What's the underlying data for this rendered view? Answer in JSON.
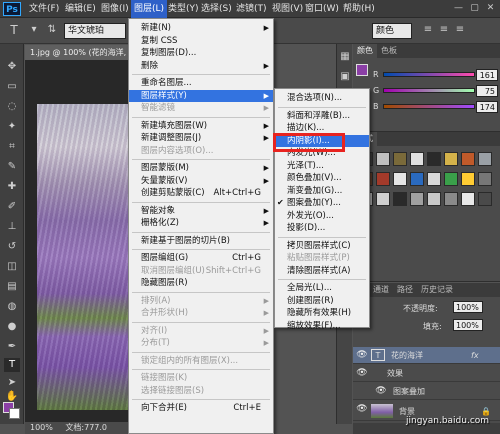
{
  "app": {
    "logo": "Ps"
  },
  "menubar": {
    "items": [
      "文件(F)",
      "编辑(E)",
      "图像(I)",
      "图层(L)",
      "类型(Y)",
      "选择(S)",
      "滤镜(T)",
      "视图(V)",
      "窗口(W)",
      "帮助(H)"
    ],
    "active": "图层(L)",
    "window_buttons": [
      "—",
      "▢",
      "✕"
    ]
  },
  "options_bar": {
    "font_family": "华文琥珀",
    "font_style": "颜色"
  },
  "document": {
    "tab_title": "1.jpg @ 100% (花的海洋, R",
    "zoom": "100%",
    "status": "文档:777.0"
  },
  "layer_menu": {
    "items": [
      {
        "label": "新建(N)",
        "shortcut": "",
        "submenu": true,
        "disabled": false
      },
      {
        "label": "复制 CSS",
        "shortcut": "",
        "submenu": false,
        "disabled": false
      },
      {
        "label": "复制图层(D)...",
        "shortcut": "",
        "submenu": false,
        "disabled": false
      },
      {
        "label": "删除",
        "shortcut": "",
        "submenu": true,
        "disabled": false
      },
      {
        "label": "重命名图层...",
        "shortcut": "",
        "submenu": false,
        "disabled": false
      },
      {
        "label": "图层样式(Y)",
        "shortcut": "",
        "submenu": true,
        "disabled": false,
        "highlighted": true
      },
      {
        "label": "智能滤镜",
        "shortcut": "",
        "submenu": true,
        "disabled": true
      },
      {
        "label": "新建填充图层(W)",
        "shortcut": "",
        "submenu": true,
        "disabled": false
      },
      {
        "label": "新建调整图层(J)",
        "shortcut": "",
        "submenu": true,
        "disabled": false
      },
      {
        "label": "图层内容选项(O)...",
        "shortcut": "",
        "submenu": false,
        "disabled": true
      },
      {
        "label": "图层蒙版(M)",
        "shortcut": "",
        "submenu": true,
        "disabled": false
      },
      {
        "label": "矢量蒙版(V)",
        "shortcut": "",
        "submenu": true,
        "disabled": false
      },
      {
        "label": "创建剪贴蒙版(C)",
        "shortcut": "Alt+Ctrl+G",
        "submenu": false,
        "disabled": false
      },
      {
        "label": "智能对象",
        "shortcut": "",
        "submenu": true,
        "disabled": false
      },
      {
        "label": "栅格化(Z)",
        "shortcut": "",
        "submenu": true,
        "disabled": false
      },
      {
        "label": "新建基于图层的切片(B)",
        "shortcut": "",
        "submenu": false,
        "disabled": false
      },
      {
        "label": "图层编组(G)",
        "shortcut": "Ctrl+G",
        "submenu": false,
        "disabled": false
      },
      {
        "label": "取消图层编组(U)",
        "shortcut": "Shift+Ctrl+G",
        "submenu": false,
        "disabled": true
      },
      {
        "label": "隐藏图层(R)",
        "shortcut": "",
        "submenu": false,
        "disabled": false
      },
      {
        "label": "排列(A)",
        "shortcut": "",
        "submenu": true,
        "disabled": true
      },
      {
        "label": "合并形状(H)",
        "shortcut": "",
        "submenu": true,
        "disabled": true
      },
      {
        "label": "对齐(I)",
        "shortcut": "",
        "submenu": true,
        "disabled": true
      },
      {
        "label": "分布(T)",
        "shortcut": "",
        "submenu": true,
        "disabled": true
      },
      {
        "label": "锁定组内的所有图层(X)...",
        "shortcut": "",
        "submenu": false,
        "disabled": true
      },
      {
        "label": "链接图层(K)",
        "shortcut": "",
        "submenu": false,
        "disabled": true
      },
      {
        "label": "选择链接图层(S)",
        "shortcut": "",
        "submenu": false,
        "disabled": true
      },
      {
        "label": "向下合并(E)",
        "shortcut": "Ctrl+E",
        "submenu": false,
        "disabled": false
      }
    ]
  },
  "style_submenu": {
    "items": [
      {
        "label": "混合选项(N)...",
        "checked": false,
        "disabled": false
      },
      {
        "label": "斜面和浮雕(B)...",
        "checked": false,
        "disabled": false
      },
      {
        "label": "描边(K)...",
        "checked": false,
        "disabled": false
      },
      {
        "label": "内阴影(I)...",
        "checked": false,
        "disabled": false,
        "highlighted": true
      },
      {
        "label": "内发光(W)...",
        "checked": false,
        "disabled": false
      },
      {
        "label": "光泽(T)...",
        "checked": false,
        "disabled": false
      },
      {
        "label": "颜色叠加(V)...",
        "checked": false,
        "disabled": false
      },
      {
        "label": "渐变叠加(G)...",
        "checked": false,
        "disabled": false
      },
      {
        "label": "图案叠加(Y)...",
        "checked": true,
        "disabled": false
      },
      {
        "label": "外发光(O)...",
        "checked": false,
        "disabled": false
      },
      {
        "label": "投影(D)...",
        "checked": false,
        "disabled": false
      },
      {
        "label": "拷贝图层样式(C)",
        "checked": false,
        "disabled": false
      },
      {
        "label": "粘贴图层样式(P)",
        "checked": false,
        "disabled": true
      },
      {
        "label": "清除图层样式(A)",
        "checked": false,
        "disabled": false
      },
      {
        "label": "全局光(L)...",
        "checked": false,
        "disabled": false
      },
      {
        "label": "创建图层(R)",
        "checked": false,
        "disabled": false
      },
      {
        "label": "隐藏所有效果(H)",
        "checked": false,
        "disabled": false
      },
      {
        "label": "缩放效果(F)...",
        "checked": false,
        "disabled": false
      }
    ]
  },
  "color_panel": {
    "tabs": [
      "颜色",
      "色板"
    ],
    "r": "161",
    "g": "75",
    "b": "174",
    "swatch_color": "#8b3fa6"
  },
  "styles_panel": {
    "tabs": [
      "样式"
    ]
  },
  "layers_panel": {
    "tabs": [
      "通道",
      "路径",
      "历史记录"
    ],
    "opacity_label": "不透明度:",
    "opacity_value": "100%",
    "fill_label": "填充:",
    "fill_value": "100%",
    "layers": [
      {
        "name": "花的海洋",
        "type": "text",
        "fx": "fx"
      },
      {
        "name": "效果",
        "type": "effect"
      },
      {
        "name": "图案叠加",
        "type": "effect-item"
      },
      {
        "name": "背景",
        "type": "image"
      }
    ]
  },
  "watermark": "jingyan.baidu.com"
}
